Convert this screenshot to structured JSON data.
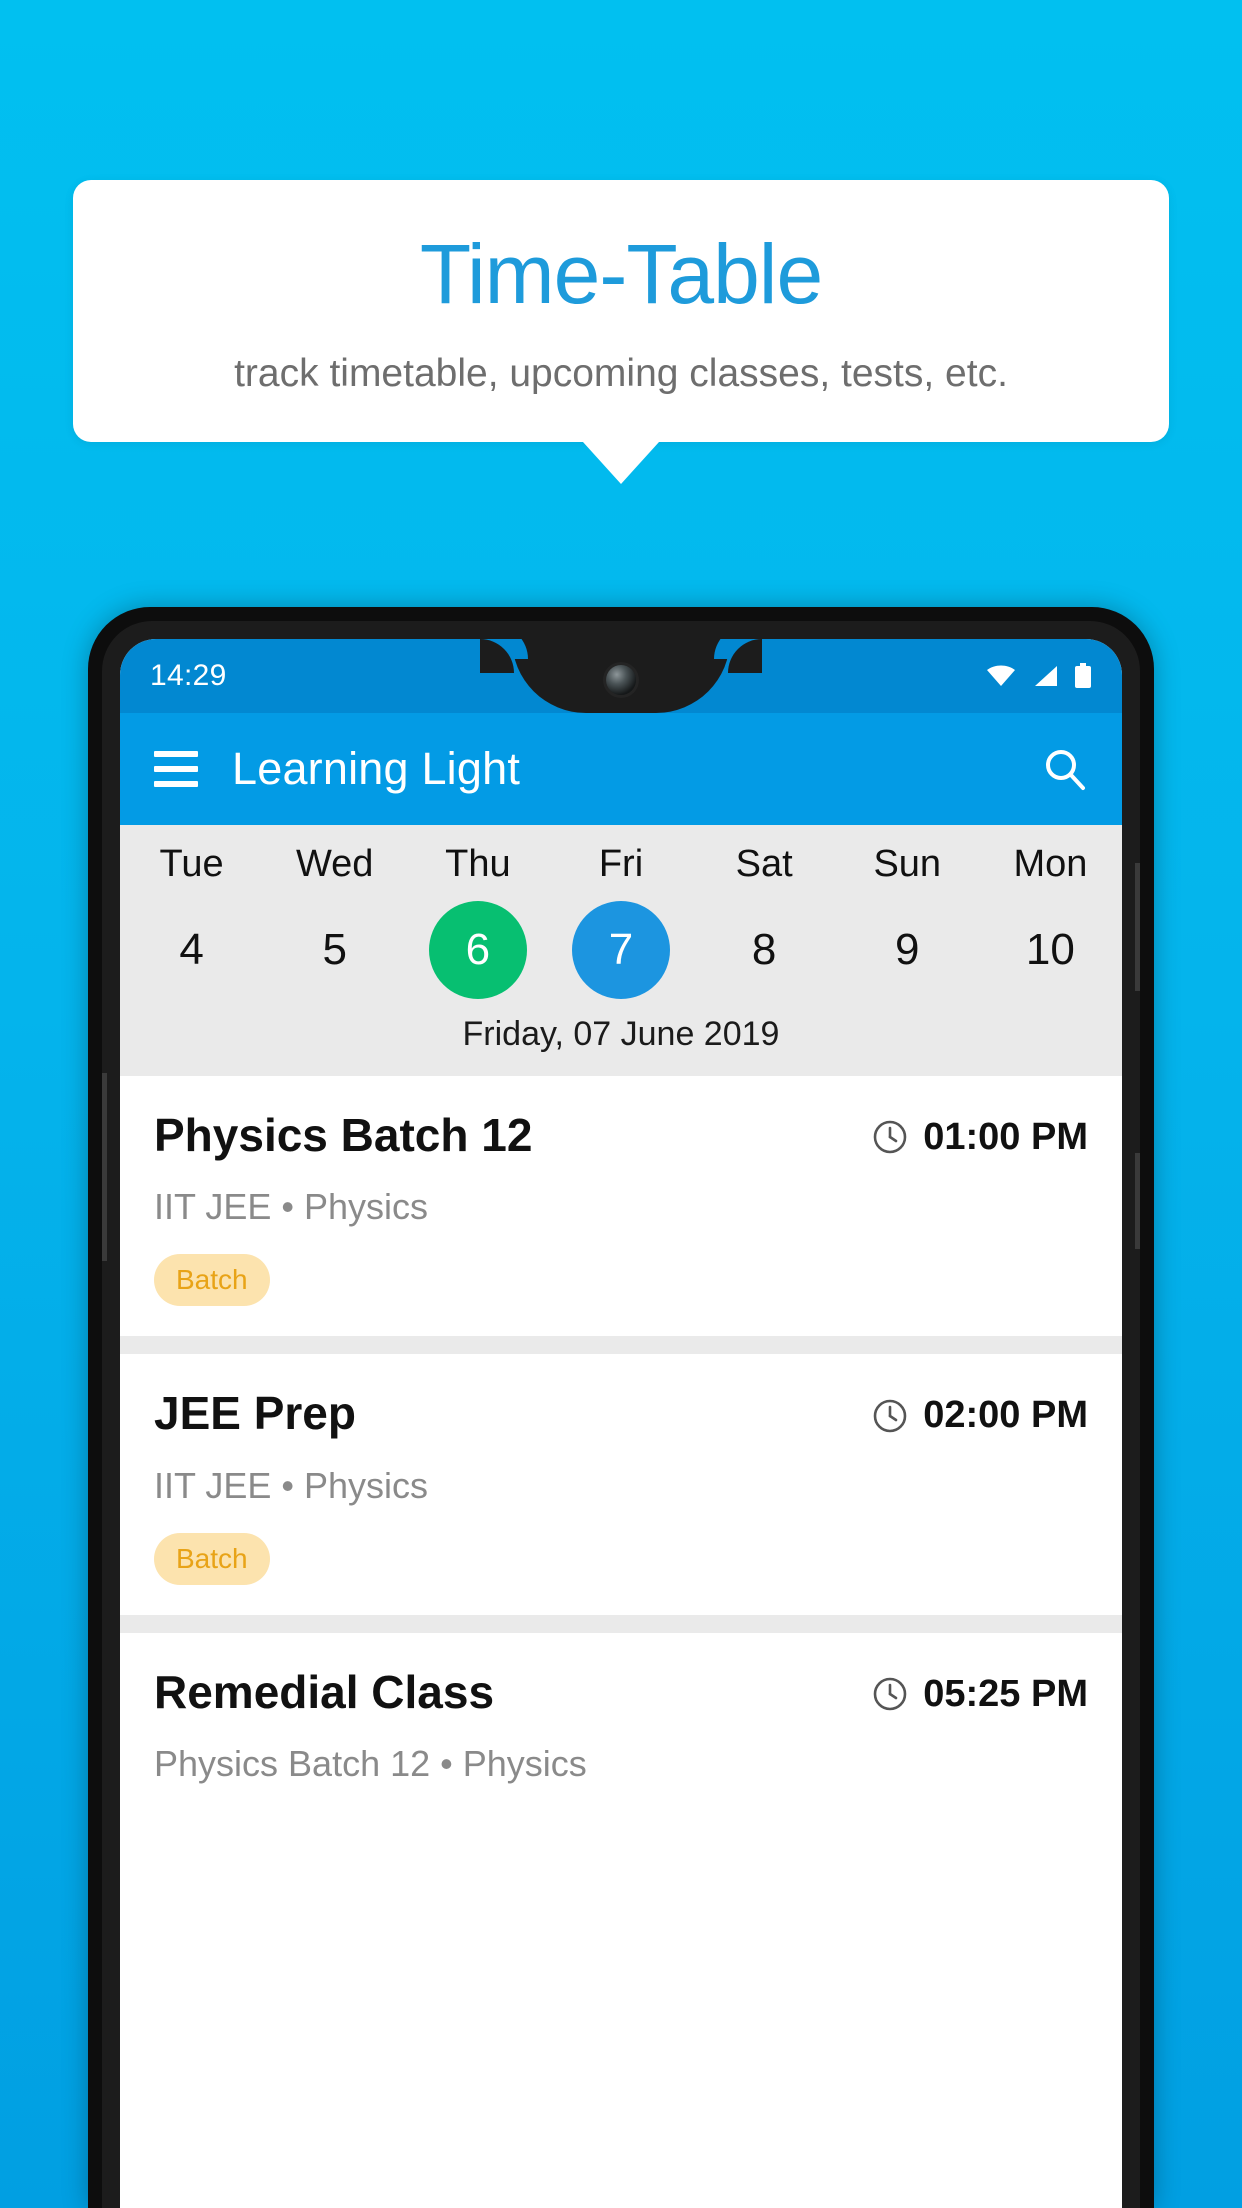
{
  "promo": {
    "title": "Time-Table",
    "subtitle": "track timetable, upcoming classes, tests, etc."
  },
  "colors": {
    "background_top": "#01C0F0",
    "background_bottom": "#019FE2",
    "app_bar": "#039BE5",
    "status_bar": "#0288D1",
    "title_blue": "#1E9BDB",
    "today_green": "#07BF71",
    "selected_blue": "#1C95E0",
    "badge_bg": "#FCE3AE",
    "badge_text": "#E8A317",
    "strip_gray": "#EAEAEA"
  },
  "phone": {
    "status_bar": {
      "time": "14:29",
      "icons": [
        "wifi-icon",
        "signal-icon",
        "battery-icon"
      ]
    },
    "app_bar": {
      "menu_icon": "hamburger-menu-icon",
      "title": "Learning Light",
      "search_icon": "search-icon"
    },
    "date_strip": {
      "days": [
        {
          "name": "Tue",
          "number": "4",
          "state": "normal"
        },
        {
          "name": "Wed",
          "number": "5",
          "state": "normal"
        },
        {
          "name": "Thu",
          "number": "6",
          "state": "today"
        },
        {
          "name": "Fri",
          "number": "7",
          "state": "selected"
        },
        {
          "name": "Sat",
          "number": "8",
          "state": "normal"
        },
        {
          "name": "Sun",
          "number": "9",
          "state": "normal"
        },
        {
          "name": "Mon",
          "number": "10",
          "state": "normal"
        }
      ],
      "full_date": "Friday, 07 June 2019"
    },
    "classes": [
      {
        "title": "Physics Batch 12",
        "time": "01:00 PM",
        "time_icon": "clock-icon",
        "subtitle": "IIT JEE • Physics",
        "badge": "Batch"
      },
      {
        "title": "JEE Prep",
        "time": "02:00 PM",
        "time_icon": "clock-icon",
        "subtitle": "IIT JEE • Physics",
        "badge": "Batch"
      },
      {
        "title": "Remedial Class",
        "time": "05:25 PM",
        "time_icon": "clock-icon",
        "subtitle": "Physics Batch 12 • Physics",
        "badge": ""
      }
    ]
  }
}
